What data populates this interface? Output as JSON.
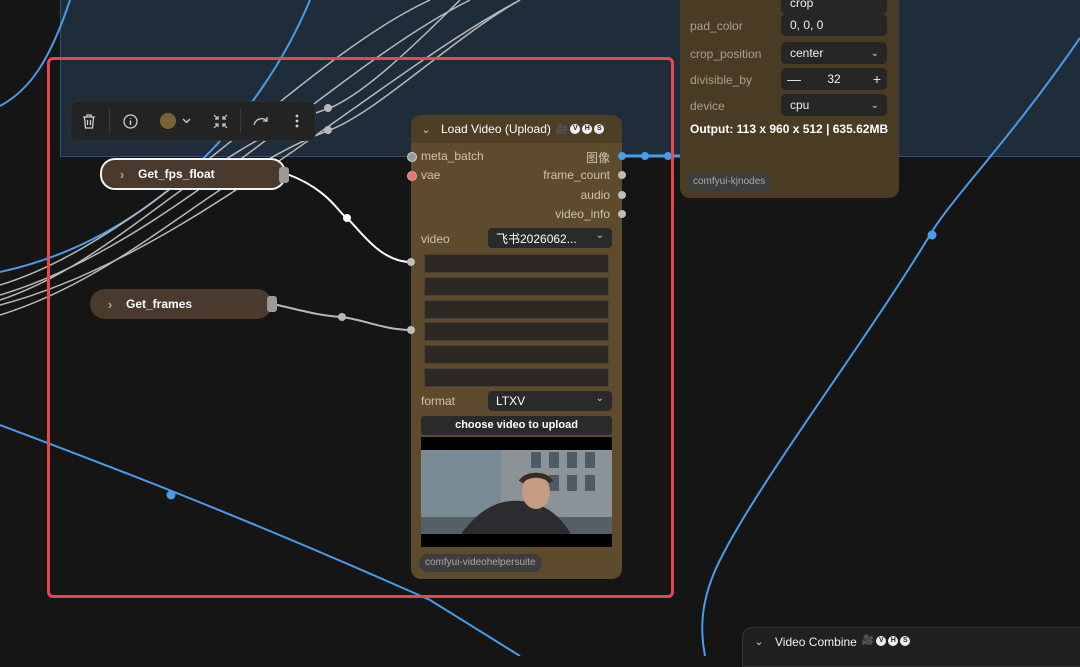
{
  "toolbar": {
    "delete_icon": "trash-icon",
    "info_icon": "info-icon",
    "color_value": "#7a6336",
    "collapse_icon": "shrink-icon",
    "redo_icon": "bypass-icon",
    "more_icon": "more-icon"
  },
  "collapsed_nodes": {
    "fps_title": "Get_fps_float",
    "frames_title": "Get_frames"
  },
  "load_video": {
    "title": "Load Video (Upload)",
    "badge_emoji": "🎥",
    "badge_letters": [
      "V",
      "H",
      "S"
    ],
    "inputs": [
      "meta_batch",
      "vae"
    ],
    "outputs": [
      "图像",
      "frame_count",
      "audio",
      "video_info"
    ],
    "video_label": "video",
    "video_value": "飞书2026062...",
    "format_label": "format",
    "format_value": "LTXV",
    "upload_button": "choose video to upload",
    "package": "comfyui-videohelpersuite"
  },
  "resize_node": {
    "top_partial_value": "crop",
    "fields": [
      {
        "label": "pad_color",
        "value": "0, 0, 0"
      },
      {
        "label": "crop_position",
        "value": "center"
      },
      {
        "label": "divisible_by",
        "value": "32"
      },
      {
        "label": "device",
        "value": "cpu"
      }
    ],
    "output": "Output: 113 x 960 x 512 | 635.62MB",
    "package": "comfyui-kjnodes"
  },
  "video_combine": {
    "title": "Video Combine",
    "badge_emoji": "🎥",
    "badge_letters": [
      "V",
      "H",
      "S"
    ]
  },
  "colors": {
    "selection": "#e5484d",
    "wire_blue": "#4a9be8",
    "node_body": "#5e4a2c",
    "group": "#1f2c3a"
  }
}
